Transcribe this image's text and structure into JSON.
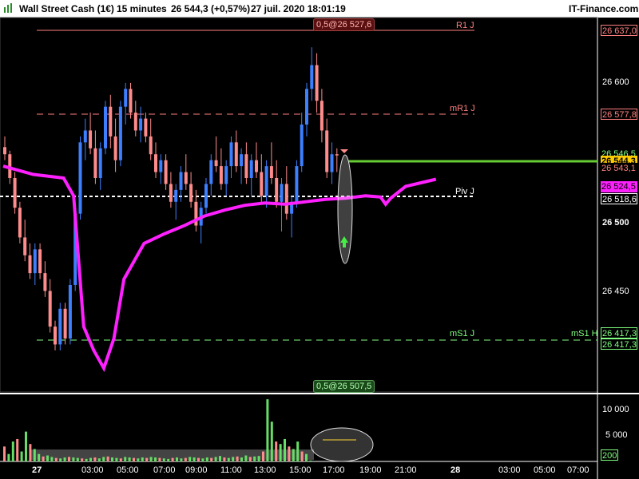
{
  "header": {
    "instrument": "Wall Street Cash (1€)",
    "timeframe": "15 minutes",
    "last_quote": "26 544,3 (+0,57%)",
    "datetime": "27 juil. 2020 18:01:19",
    "brand": "IT-Finance.com"
  },
  "levels": {
    "r1": {
      "label": "R1 J",
      "price_label": "26 637,0",
      "color": "#ff8080"
    },
    "mr1": {
      "label": "mR1 J",
      "price_label": "26 577,8",
      "color": "#ff8080"
    },
    "piv": {
      "label": "Piv J",
      "price_label": "26 518,6",
      "color": "#ffffff"
    },
    "ms1": {
      "label": "mS1 J",
      "price_label": "26 417,3",
      "color": "#80ff80"
    },
    "ms1h": {
      "label": "mS1 H",
      "price_label": "26 417,3",
      "color": "#80ff80"
    }
  },
  "price_axis": {
    "ticks": [
      "26 600",
      "26 500",
      "26 450"
    ],
    "labels": {
      "high_green": "26 546,5",
      "last": "26 544,3",
      "red": "26 543,1",
      "ma": "26 524,5"
    }
  },
  "annotations": {
    "top_box": "0,5@26 527,6",
    "bottom_box": "0,5@26 507,5"
  },
  "volume_axis": {
    "ticks": [
      "10 000",
      "5 000"
    ],
    "last_volume": "200"
  },
  "time_axis": {
    "labels": [
      "27",
      "03:00",
      "05:00",
      "07:00",
      "09:00",
      "11:00",
      "13:00",
      "15:00",
      "17:00",
      "19:00",
      "21:00",
      "28",
      "03:00",
      "05:00",
      "07:00"
    ]
  },
  "colors": {
    "up": "#3d7fff",
    "down": "#ff8c8c",
    "moving_average": "#ff20ff",
    "last_price_line": "#66cc33",
    "background": "#000000"
  },
  "chart_data": {
    "type": "candlestick",
    "ma_name": "",
    "price_range": [
      26345,
      26660
    ],
    "candles": [
      [
        26551,
        26560,
        26540,
        26545
      ],
      [
        26545,
        26548,
        26520,
        26525
      ],
      [
        26525,
        26530,
        26495,
        26500
      ],
      [
        26500,
        26505,
        26470,
        26475
      ],
      [
        26475,
        26490,
        26455,
        26460
      ],
      [
        26460,
        26470,
        26440,
        26445
      ],
      [
        26445,
        26470,
        26435,
        26465
      ],
      [
        26465,
        26470,
        26440,
        26445
      ],
      [
        26445,
        26455,
        26425,
        26430
      ],
      [
        26430,
        26440,
        26395,
        26400
      ],
      [
        26400,
        26405,
        26380,
        26385
      ],
      [
        26385,
        26420,
        26380,
        26415
      ],
      [
        26415,
        26420,
        26385,
        26390
      ],
      [
        26390,
        26440,
        26385,
        26435
      ],
      [
        26435,
        26500,
        26430,
        26495
      ],
      [
        26495,
        26560,
        26490,
        26555
      ],
      [
        26555,
        26575,
        26540,
        26565
      ],
      [
        26565,
        26580,
        26545,
        26550
      ],
      [
        26550,
        26565,
        26520,
        26525
      ],
      [
        26525,
        26555,
        26515,
        26550
      ],
      [
        26550,
        26590,
        26545,
        26585
      ],
      [
        26585,
        26595,
        26550,
        26560
      ],
      [
        26560,
        26575,
        26530,
        26540
      ],
      [
        26540,
        26590,
        26535,
        26585
      ],
      [
        26585,
        26605,
        26570,
        26600
      ],
      [
        26600,
        26605,
        26575,
        26580
      ],
      [
        26580,
        26590,
        26560,
        26565
      ],
      [
        26565,
        26585,
        26555,
        26575
      ],
      [
        26575,
        26580,
        26555,
        26560
      ],
      [
        26560,
        26575,
        26540,
        26545
      ],
      [
        26545,
        26555,
        26525,
        26530
      ],
      [
        26530,
        26545,
        26520,
        26540
      ],
      [
        26540,
        26545,
        26515,
        26520
      ],
      [
        26520,
        26530,
        26500,
        26505
      ],
      [
        26505,
        26520,
        26490,
        26515
      ],
      [
        26515,
        26535,
        26505,
        26530
      ],
      [
        26530,
        26545,
        26515,
        26520
      ],
      [
        26520,
        26530,
        26500,
        26505
      ],
      [
        26505,
        26515,
        26480,
        26485
      ],
      [
        26485,
        26505,
        26470,
        26500
      ],
      [
        26500,
        26525,
        26495,
        26520
      ],
      [
        26520,
        26545,
        26510,
        26540
      ],
      [
        26540,
        26560,
        26530,
        26535
      ],
      [
        26535,
        26550,
        26515,
        26520
      ],
      [
        26520,
        26540,
        26510,
        26535
      ],
      [
        26535,
        26560,
        26525,
        26555
      ],
      [
        26555,
        26565,
        26530,
        26535
      ],
      [
        26535,
        26550,
        26520,
        26545
      ],
      [
        26545,
        26555,
        26520,
        26525
      ],
      [
        26525,
        26545,
        26510,
        26540
      ],
      [
        26540,
        26555,
        26525,
        26530
      ],
      [
        26530,
        26545,
        26505,
        26510
      ],
      [
        26510,
        26540,
        26500,
        26535
      ],
      [
        26535,
        26555,
        26520,
        26525
      ],
      [
        26525,
        26540,
        26500,
        26505
      ],
      [
        26505,
        26525,
        26480,
        26520
      ],
      [
        26520,
        26535,
        26490,
        26495
      ],
      [
        26495,
        26510,
        26475,
        26505
      ],
      [
        26505,
        26540,
        26500,
        26535
      ],
      [
        26535,
        26580,
        26530,
        26570
      ],
      [
        26570,
        26605,
        26560,
        26600
      ],
      [
        26600,
        26635,
        26590,
        26620
      ],
      [
        26620,
        26630,
        26580,
        26590
      ],
      [
        26590,
        26600,
        26555,
        26565
      ],
      [
        26565,
        26575,
        26525,
        26530
      ],
      [
        26530,
        26555,
        26520,
        26545
      ],
      [
        26545,
        26550,
        26530,
        26544
      ]
    ],
    "volumes": [
      3000,
      1500,
      4000,
      4500,
      2000,
      6000,
      3500,
      2500,
      1500,
      1000,
      1200,
      900,
      700,
      600,
      800,
      900,
      800,
      700,
      600,
      500,
      700,
      800,
      600,
      900,
      1000,
      800,
      700,
      600,
      900,
      800,
      700,
      600,
      800,
      700,
      900,
      800,
      700,
      600,
      500,
      700,
      800,
      600,
      700,
      900,
      800,
      700,
      600,
      800,
      700,
      900,
      1100,
      800,
      700,
      900,
      1000,
      800,
      1200,
      900,
      1000,
      1100,
      2000,
      12500,
      8000,
      4000,
      3500,
      4500,
      3000,
      2500,
      4000,
      2000,
      1500,
      200
    ],
    "ma": [
      [
        0,
        26535
      ],
      [
        6,
        26528
      ],
      [
        12,
        26525
      ],
      [
        14,
        26510
      ],
      [
        16,
        26400
      ],
      [
        18,
        26380
      ],
      [
        20,
        26365
      ],
      [
        22,
        26390
      ],
      [
        24,
        26440
      ],
      [
        28,
        26470
      ],
      [
        32,
        26478
      ],
      [
        36,
        26485
      ],
      [
        40,
        26493
      ],
      [
        44,
        26498
      ],
      [
        48,
        26502
      ],
      [
        52,
        26504
      ],
      [
        56,
        26503
      ],
      [
        60,
        26505
      ],
      [
        64,
        26507
      ],
      [
        68,
        26508
      ],
      [
        72,
        26510
      ],
      [
        75,
        26509
      ],
      [
        76,
        26503
      ],
      [
        77,
        26508
      ],
      [
        80,
        26518
      ],
      [
        84,
        26522
      ],
      [
        86,
        26524
      ]
    ]
  }
}
